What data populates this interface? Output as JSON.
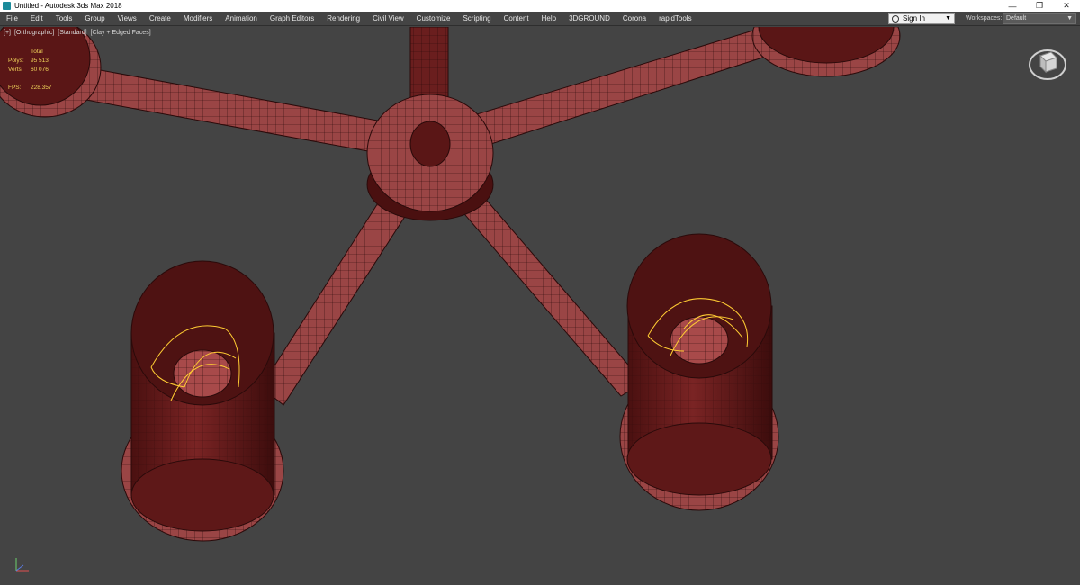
{
  "window": {
    "title": "Untitled - Autodesk 3ds Max 2018",
    "minimize_glyph": "—",
    "maximize_glyph": "❐",
    "close_glyph": "✕"
  },
  "menu": {
    "items": [
      "File",
      "Edit",
      "Tools",
      "Group",
      "Views",
      "Create",
      "Modifiers",
      "Animation",
      "Graph Editors",
      "Rendering",
      "Civil View",
      "Customize",
      "Scripting",
      "Content",
      "Help",
      "3DGROUND",
      "Corona",
      "rapidTools"
    ]
  },
  "account": {
    "signin_label": "Sign In",
    "workspaces_label": "Workspaces:",
    "workspace_value": "Default"
  },
  "viewport": {
    "labels": [
      "[+]",
      "[Orthographic]",
      "[Standard]",
      "[Clay + Edged Faces]"
    ],
    "stats": {
      "header": "Total",
      "polys_label": "Polys:",
      "polys_value": "95 513",
      "verts_label": "Verts:",
      "verts_value": "60 076",
      "fps_label": "FPS:",
      "fps_value": "228.357"
    }
  },
  "colors": {
    "viewport_bg": "#444444",
    "model_fill": "#8f3a3a",
    "model_dark": "#5a1616",
    "wire": "#2a0a0a",
    "light_gizmo": "#ffcc33"
  },
  "icons": {
    "app": "3ds-max-icon",
    "user": "user-icon",
    "viewcube": "viewcube-icon",
    "axis": "axis-tripod-icon"
  }
}
